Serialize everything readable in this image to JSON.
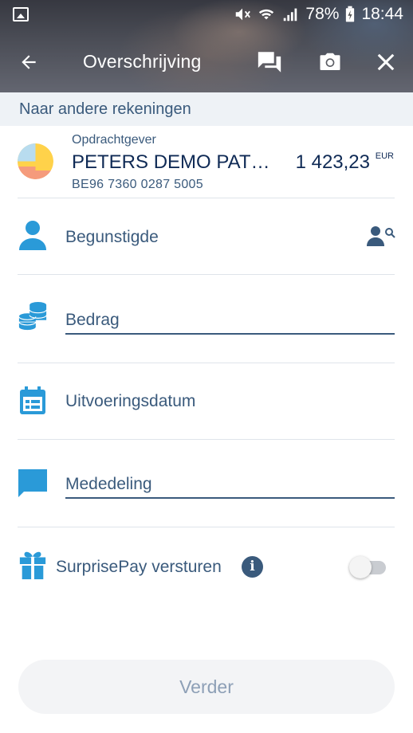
{
  "status_bar": {
    "battery_percent": "78%",
    "time": "18:44"
  },
  "header": {
    "title": "Overschrijving"
  },
  "subheader": {
    "text": "Naar andere rekeningen"
  },
  "account": {
    "label": "Opdrachtgever",
    "name": "PETERS DEMO PATRI…",
    "iban": "BE96 7360 0287 5005",
    "amount": "1 423,23",
    "currency": "EUR"
  },
  "form": {
    "beneficiary_label": "Begunstigde",
    "amount_label": "Bedrag",
    "date_label": "Uitvoeringsdatum",
    "message_label": "Mededeling",
    "surprisepay_label": "SurprisePay versturen",
    "info_glyph": "i",
    "surprisepay_enabled": false
  },
  "cta": {
    "label": "Verder"
  },
  "colors": {
    "accent_blue": "#2a9ad8",
    "text_blue": "#3a5a7c",
    "dark_navy": "#0f2a55",
    "divider": "#dfe4ea"
  },
  "icons": [
    "gallery-icon",
    "mute-icon",
    "wifi-icon",
    "signal-icon",
    "battery-icon",
    "back-arrow-icon",
    "chat-icon",
    "camera-icon",
    "close-icon",
    "user-icon",
    "contact-search-icon",
    "coins-icon",
    "calendar-icon",
    "message-icon",
    "gift-icon",
    "info-icon"
  ]
}
